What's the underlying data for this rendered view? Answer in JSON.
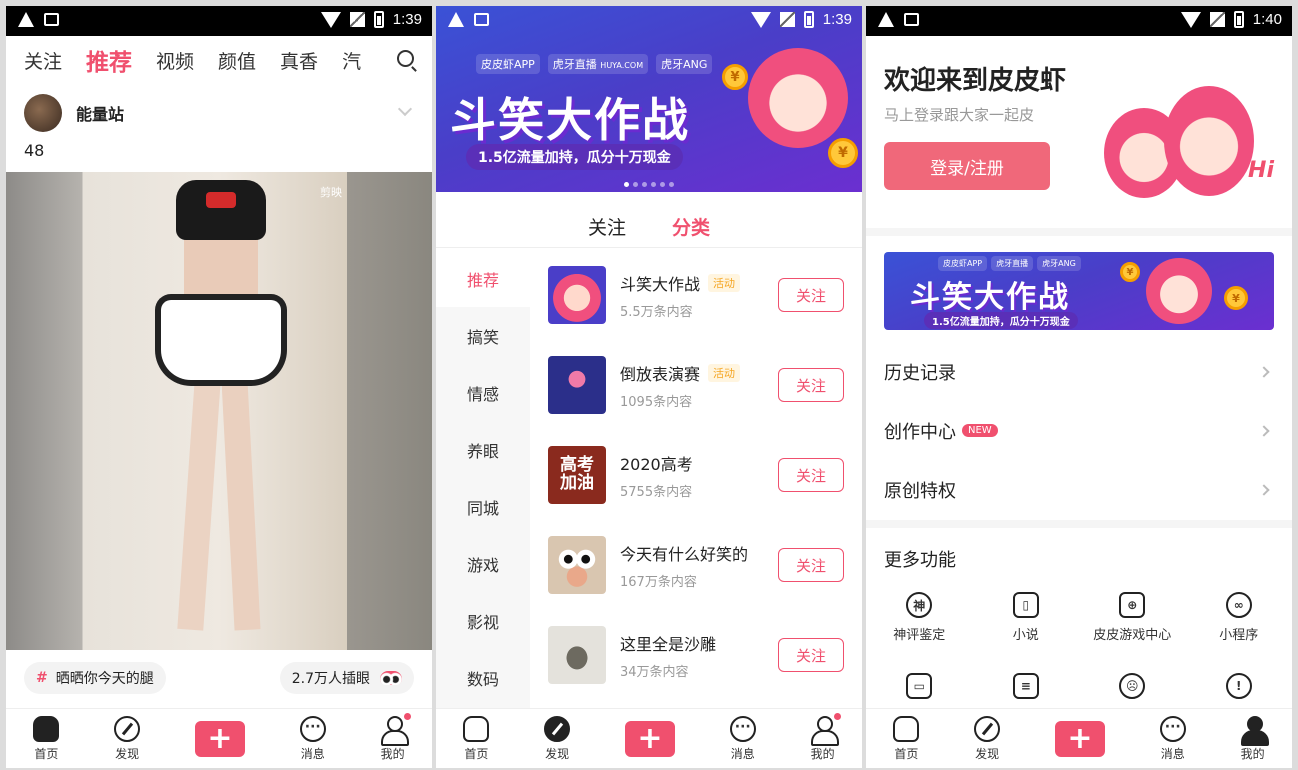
{
  "status_bars": [
    {
      "time": "1:39"
    },
    {
      "time": "1:39"
    },
    {
      "time": "1:40"
    }
  ],
  "feed": {
    "tabs": [
      "关注",
      "推荐",
      "视频",
      "颜值",
      "真香",
      "汽"
    ],
    "active_tab": "推荐",
    "author": "能量站",
    "count": "48",
    "watermark": "剪映",
    "topic": "晒晒你今天的腿",
    "views": "2.7万人插眼"
  },
  "nav": {
    "home": "首页",
    "discover": "发现",
    "messages": "消息",
    "me": "我的"
  },
  "banner": {
    "brand1": "皮皮虾APP",
    "brand2": "虎牙直播",
    "brand2_sub": "HUYA.COM",
    "brand3": "虎牙ANG",
    "title": "斗笑大作战",
    "subtitle": "1.5亿流量加持，瓜分十万现金",
    "coin": "¥"
  },
  "category": {
    "segments": [
      "关注",
      "分类"
    ],
    "active_segment": "分类",
    "sidebar": [
      "推荐",
      "搞笑",
      "情感",
      "养眼",
      "同城",
      "游戏",
      "影视",
      "数码"
    ],
    "active_sidebar": "推荐",
    "follow_label": "关注",
    "items": [
      {
        "title": "斗笑大作战",
        "tag": "活动",
        "sub": "5.5万条内容"
      },
      {
        "title": "倒放表演赛",
        "tag": "活动",
        "sub": "1095条内容"
      },
      {
        "title": "2020高考",
        "tag": "",
        "sub": "5755条内容",
        "thumb_text": "高考加油"
      },
      {
        "title": "今天有什么好笑的",
        "tag": "",
        "sub": "167万条内容"
      },
      {
        "title": "这里全是沙雕",
        "tag": "",
        "sub": "34万条内容"
      }
    ]
  },
  "profile": {
    "welcome": "欢迎来到皮皮虾",
    "subtitle": "马上登录跟大家一起皮",
    "login": "登录/注册",
    "hi": "Hi",
    "menu": [
      {
        "label": "历史记录",
        "badge": ""
      },
      {
        "label": "创作中心",
        "badge": "NEW"
      },
      {
        "label": "原创特权",
        "badge": ""
      }
    ],
    "more_title": "更多功能",
    "features": [
      {
        "label": "神评鉴定",
        "glyph": "神"
      },
      {
        "label": "小说",
        "glyph": "▯"
      },
      {
        "label": "皮皮游戏中心",
        "glyph": "⊕"
      },
      {
        "label": "小程序",
        "glyph": "∞"
      }
    ],
    "features_row2": [
      "▭",
      "≡",
      "☹",
      "!"
    ]
  }
}
